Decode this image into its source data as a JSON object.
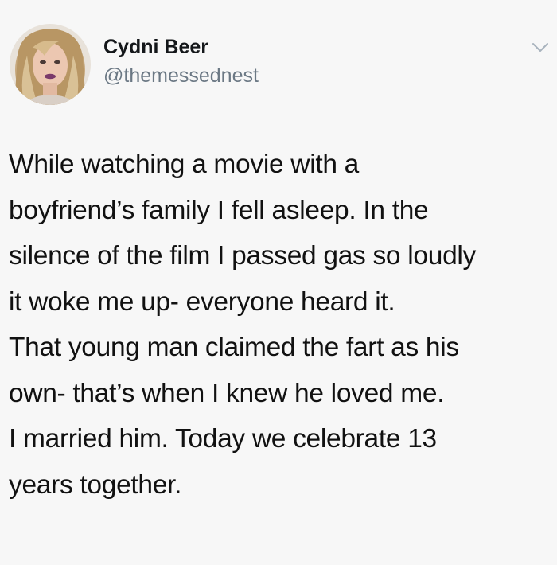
{
  "author": {
    "name": "Cydni Beer",
    "handle": "@themessednest"
  },
  "tweet": {
    "lines": [
      "While watching a movie with a",
      "boyfriend’s family I fell asleep. In the",
      "silence of the film I passed gas so loudly",
      "it woke me up- everyone heard it.",
      "That young man claimed the fart as his",
      "own- that’s when I knew he loved me.",
      "I married him. Today we celebrate 13",
      "years together."
    ]
  },
  "icons": {
    "menu": "chevron-down-icon"
  },
  "colors": {
    "background": "#f7f7f7",
    "name": "#14171a",
    "handle": "#6b7884",
    "text": "#111111"
  }
}
